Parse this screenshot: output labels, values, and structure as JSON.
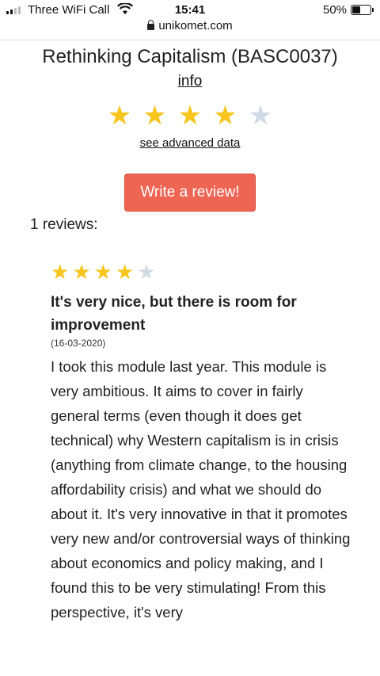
{
  "status_bar": {
    "carrier": "Three WiFi Call",
    "time": "15:41",
    "battery": "50%"
  },
  "url_bar": {
    "domain": "unikomet.com"
  },
  "module": {
    "title": "Rethinking Capitalism (BASC0037)",
    "info_link": "info",
    "rating": 4,
    "rating_max": 5,
    "advanced_link": "see advanced data"
  },
  "write_review_button": "Write a review!",
  "reviews_count_label": "1 reviews:",
  "reviews": [
    {
      "rating": 4,
      "title": "It's very nice, but there is room for improvement",
      "date": "(16-03-2020)",
      "body": "I took this module last year. This module is very ambitious. It aims to cover in fairly general terms (even though it does get technical) why Western capitalism is in crisis (anything from climate change, to the housing affordability crisis) and what we should do about it. It's very innovative in that it promotes very new and/or controversial ways of thinking about economics and policy making, and I found this to be very stimulating! From this perspective, it's very"
    }
  ],
  "colors": {
    "star_filled": "#f7c51e",
    "star_empty": "#d0dae4",
    "button": "#ee6554"
  }
}
